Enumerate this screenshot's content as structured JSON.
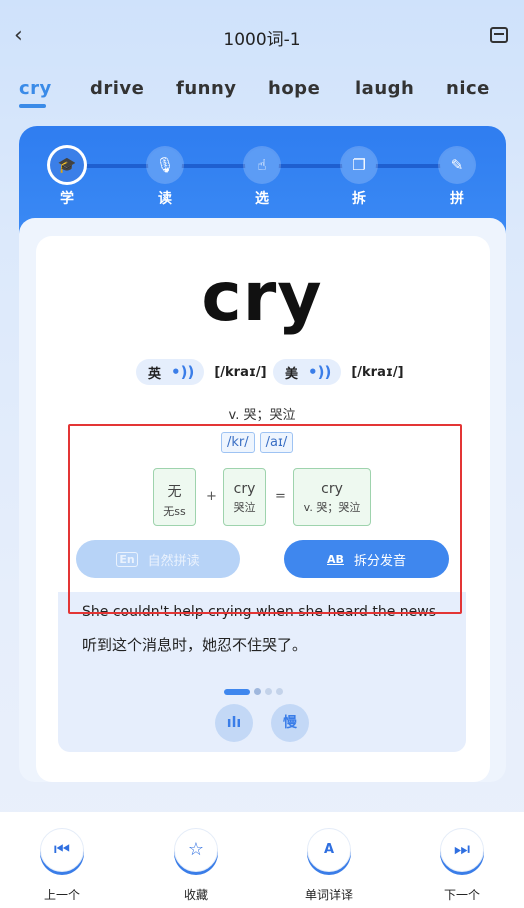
{
  "header": {
    "title": "1000词-1",
    "back_icon": "chevron-left-icon",
    "bookmark_icon": "bookmark-icon"
  },
  "tabs": [
    "cry",
    "drive",
    "funny",
    "hope",
    "laugh",
    "nice"
  ],
  "active_tab": "cry",
  "steps": [
    {
      "label": "学",
      "icon": "graduation-cap-icon"
    },
    {
      "label": "读",
      "icon": "microphone-icon"
    },
    {
      "label": "选",
      "icon": "tap-icon"
    },
    {
      "label": "拆",
      "icon": "layers-icon"
    },
    {
      "label": "拼",
      "icon": "pencil-icon"
    }
  ],
  "word": {
    "text": "cry",
    "uk_label": "英",
    "uk_ipa": "[/kraɪ/]",
    "us_label": "美",
    "us_ipa": "[/kraɪ/]",
    "meaning": "v. 哭；哭泣"
  },
  "phonemes": [
    "/kr/",
    "/aɪ/"
  ],
  "parts": [
    {
      "main": "无",
      "sub": "无ss"
    },
    {
      "main": "cry",
      "sub": "哭泣"
    },
    {
      "main": "cry",
      "sub": "v. 哭；哭泣"
    }
  ],
  "ops": {
    "plus": "+",
    "equals": "="
  },
  "buttons": {
    "natural": "自然拼读",
    "natural_icon": "En",
    "split": "拆分发音",
    "split_icon": "AB"
  },
  "example": {
    "en": "She couldn't help crying when she heard the news",
    "zh": "听到这个消息时，她忍不住哭了。",
    "slow_label": "慢"
  },
  "toolbar": [
    {
      "label": "上一个",
      "icon": "skip-previous-icon"
    },
    {
      "label": "收藏",
      "icon": "star-icon"
    },
    {
      "label": "单词详译",
      "icon": "dictionary-icon"
    },
    {
      "label": "下一个",
      "icon": "skip-next-icon"
    }
  ],
  "colors": {
    "accent": "#3f87ee",
    "highlight_border": "#e33535"
  }
}
